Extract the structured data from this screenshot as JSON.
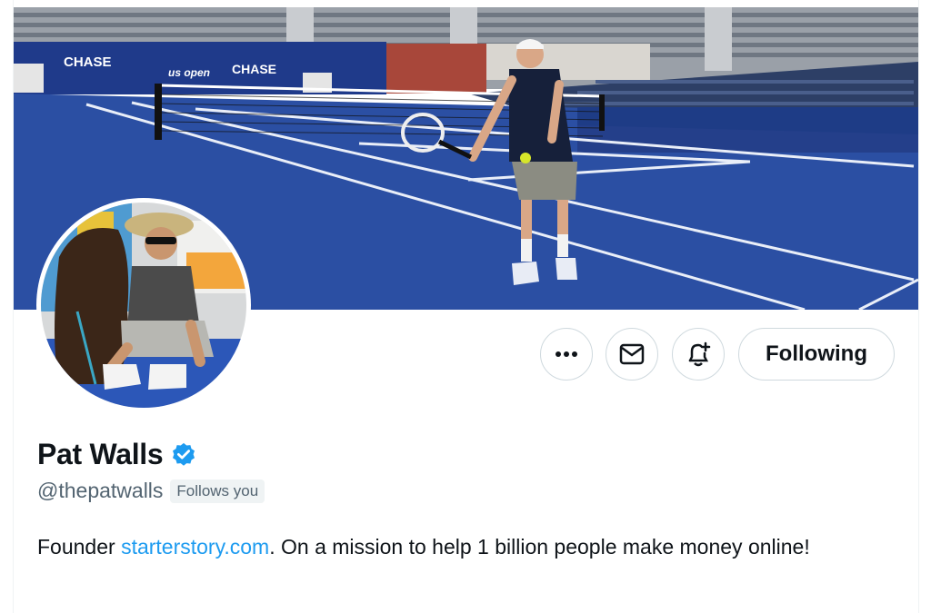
{
  "banner": {
    "signage": [
      "CHASE",
      "us open",
      "CHASE"
    ]
  },
  "actions": {
    "more_icon": "more-horizontal-icon",
    "message_icon": "envelope-icon",
    "notify_icon": "bell-plus-icon",
    "following_label": "Following"
  },
  "profile": {
    "display_name": "Pat Walls",
    "verified_icon": "verified-badge-icon",
    "handle": "@thepatwalls",
    "follows_you": "Follows you",
    "bio_prefix": "Founder ",
    "bio_link": "starterstory.com",
    "bio_suffix": ". On a mission to help 1 billion people make money online!"
  },
  "colors": {
    "link": "#1d9bf0",
    "verified": "#1d9bf0",
    "court": "#2b4fa3",
    "text_secondary": "#536471"
  }
}
